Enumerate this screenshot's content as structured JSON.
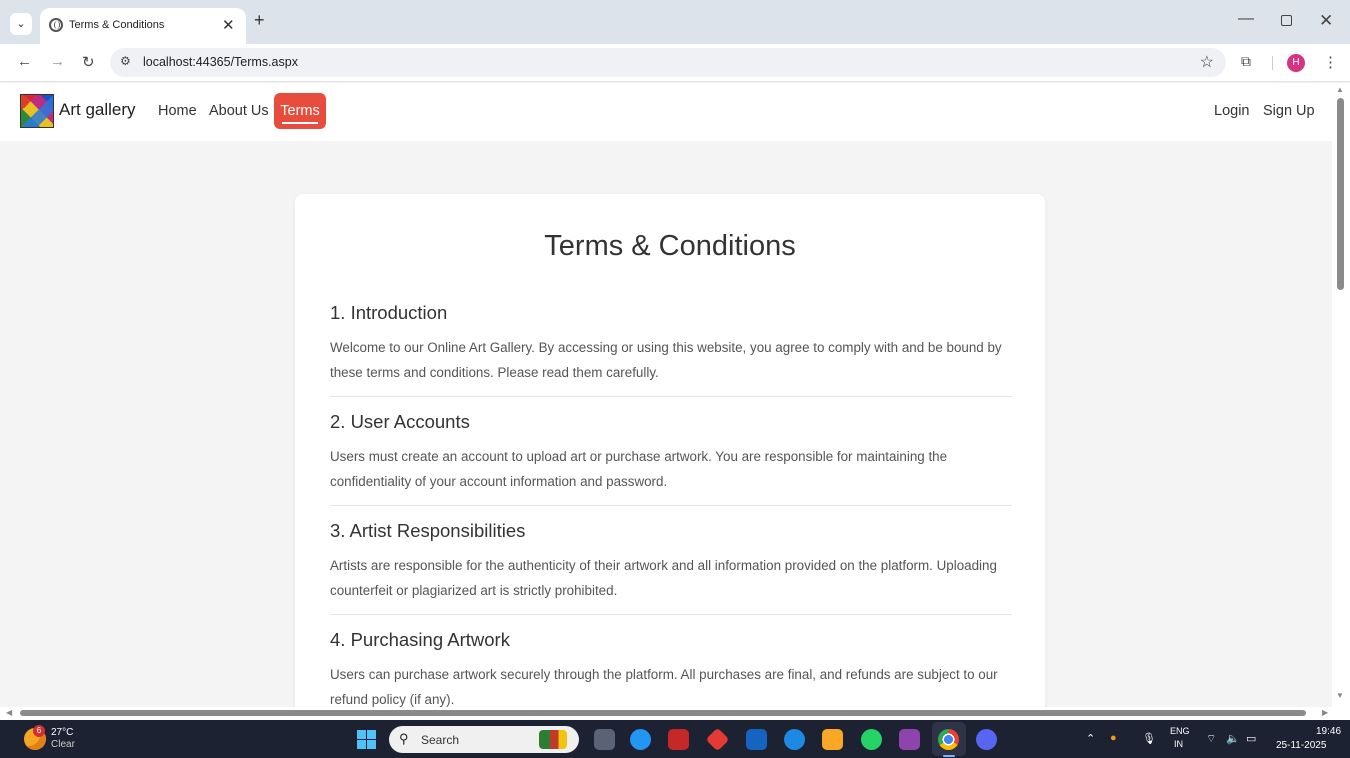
{
  "browser": {
    "tab_title": "Terms & Conditions",
    "tab_close": "✕",
    "new_tab": "+",
    "url": "localhost:44365/Terms.aspx",
    "profile_initial": "H"
  },
  "site": {
    "brand": "Art gallery",
    "nav": {
      "home": "Home",
      "about": "About Us",
      "terms": "Terms",
      "login": "Login",
      "signup": "Sign Up"
    },
    "accent_color": "#e74c3c"
  },
  "content": {
    "title": "Terms & Conditions",
    "sections": [
      {
        "heading": "1. Introduction",
        "text": "Welcome to our Online Art Gallery. By accessing or using this website, you agree to comply with and be bound by these terms and conditions. Please read them carefully."
      },
      {
        "heading": "2. User Accounts",
        "text": "Users must create an account to upload art or purchase artwork. You are responsible for maintaining the confidentiality of your account information and password."
      },
      {
        "heading": "3. Artist Responsibilities",
        "text": "Artists are responsible for the authenticity of their artwork and all information provided on the platform. Uploading counterfeit or plagiarized art is strictly prohibited."
      },
      {
        "heading": "4. Purchasing Artwork",
        "text": "Users can purchase artwork securely through the platform. All purchases are final, and refunds are subject to our refund policy (if any)."
      }
    ]
  },
  "taskbar": {
    "weather_badge": "6",
    "temperature": "27°C",
    "condition": "Clear",
    "search_placeholder": "Search",
    "lang_primary": "ENG",
    "lang_secondary": "IN",
    "time": "19:46",
    "date": "25-11-2025"
  }
}
